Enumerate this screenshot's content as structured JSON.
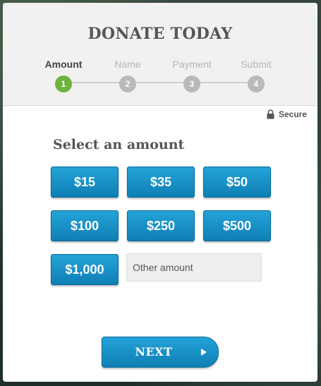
{
  "title": "DONATE TODAY",
  "steps": [
    {
      "label": "Amount",
      "number": "1",
      "active": true
    },
    {
      "label": "Name",
      "number": "2",
      "active": false
    },
    {
      "label": "Payment",
      "number": "3",
      "active": false
    },
    {
      "label": "Submit",
      "number": "4",
      "active": false
    }
  ],
  "secure": {
    "label": "Secure",
    "icon": "lock-icon"
  },
  "section_title": "Select an amount",
  "amounts": [
    "$15",
    "$35",
    "$50",
    "$100",
    "$250",
    "$500",
    "$1,000"
  ],
  "other_amount": {
    "placeholder": "Other amount",
    "value": ""
  },
  "next_button": {
    "label": "NEXT",
    "icon": "play-icon"
  },
  "colors": {
    "accent": "#1691c8",
    "active_step": "#6cb33f",
    "inactive_step": "#b9b9b9",
    "header_bg": "#f1f1f1"
  }
}
